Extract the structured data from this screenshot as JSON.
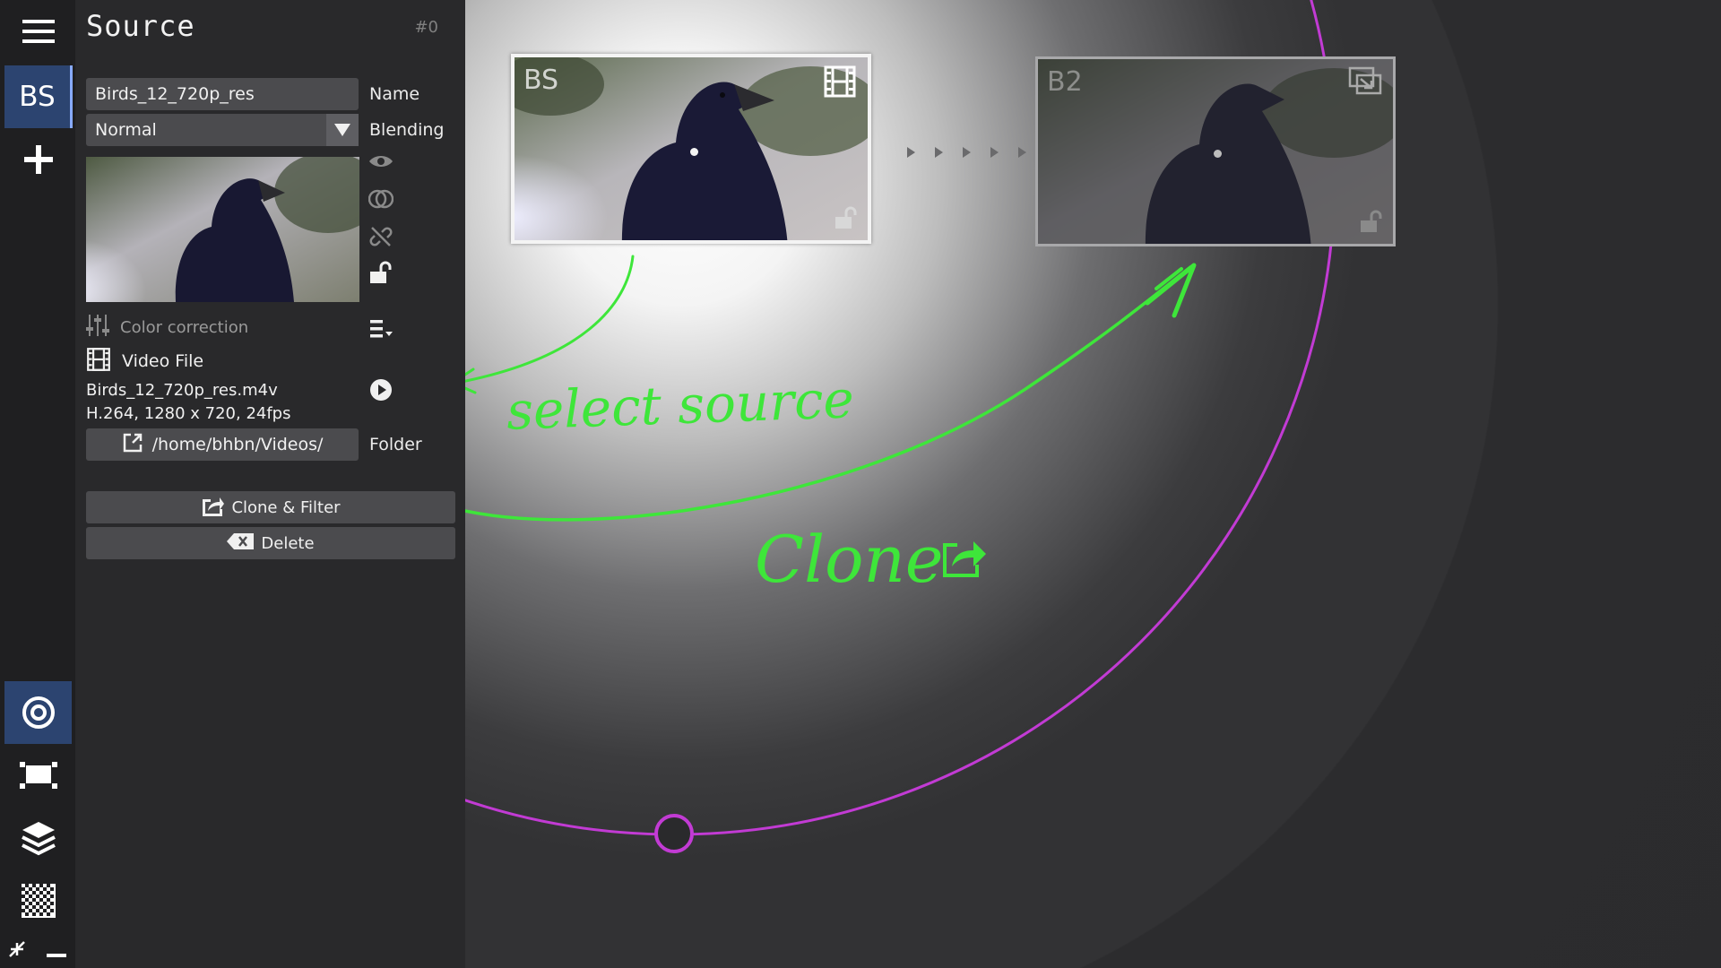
{
  "toolbar": {
    "top": [
      {
        "name": "menu-icon"
      },
      {
        "name": "source-tab-bs",
        "label": "BS",
        "active": true
      },
      {
        "name": "add-icon"
      }
    ],
    "bottom": [
      {
        "name": "target-icon",
        "active": true
      },
      {
        "name": "geometry-icon"
      },
      {
        "name": "layers-icon"
      },
      {
        "name": "checkerboard-icon"
      },
      {
        "name": "collapse-icon"
      },
      {
        "name": "minus-icon"
      }
    ]
  },
  "panel": {
    "title": "Source",
    "index": "#0",
    "name_value": "Birds_12_720p_res",
    "name_label": "Name",
    "blending_value": "Normal",
    "blending_label": "Blending",
    "color_correction": "Color correction",
    "video_file_label": "Video File",
    "file_name": "Birds_12_720p_res.m4v",
    "file_info": "H.264, 1280 x 720, 24fps",
    "folder_path": "/home/bhbn/Videos/",
    "folder_label": "Folder",
    "clone_button": "Clone & Filter",
    "delete_button": "Delete",
    "side_icons": [
      "eye-icon",
      "transparency-icon",
      "unlink-icon",
      "unlock-icon"
    ]
  },
  "nodes": [
    {
      "label": "BS",
      "type_icon": "film-icon",
      "selected": true
    },
    {
      "label": "B2",
      "type_icon": "clone-icon",
      "selected": false
    }
  ],
  "annotations": {
    "select": "select source",
    "clone": "Clone"
  },
  "colors": {
    "accent_green": "#3ee63a",
    "ring_purple": "#c23bd4",
    "active_tab": "#2c4470",
    "panel_bg": "#29292b",
    "toolbar_bg": "#1f1f21"
  }
}
